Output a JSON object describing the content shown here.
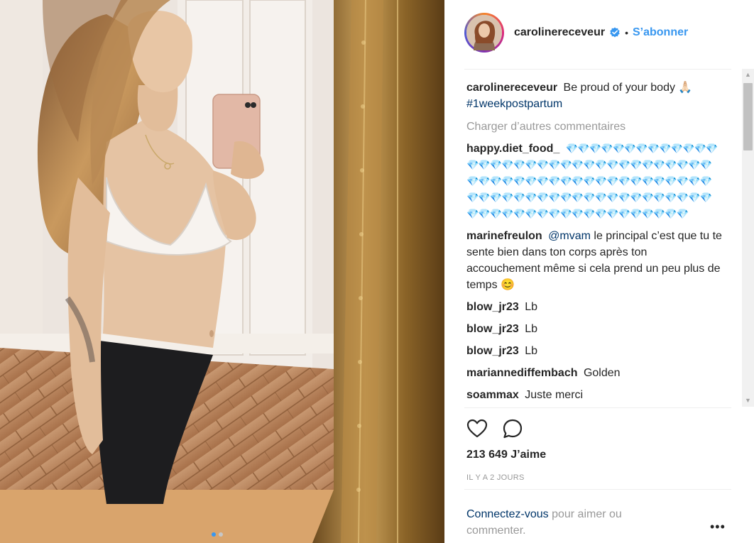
{
  "post": {
    "username": "carolinereceveur",
    "separator": "•",
    "follow_label": "S’abonner",
    "carousel": {
      "count": 2,
      "active": 1
    }
  },
  "caption": {
    "user": "carolinereceveur",
    "text": "Be proud of your body 🙏🏻",
    "hashtag": "#1weekpostpartum"
  },
  "load_more_label": "Charger d’autres commentaires",
  "comments": [
    {
      "user": "happy.diet_food_",
      "text": "💎💎💎💎💎💎💎💎💎💎💎💎💎💎💎💎💎💎💎💎💎💎💎💎💎💎💎💎💎💎💎💎💎💎💎💎💎💎💎💎💎💎💎💎💎💎💎💎💎💎💎💎💎💎💎💎💎💎💎💎💎💎💎💎💎💎💎💎💎💎💎💎💎💎💎💎💎💎💎💎💎💎💎💎💎💎💎💎💎💎💎💎💎💎💎"
    },
    {
      "user": "marinefreulon",
      "mention": "@mvam",
      "text": "le principal c’est que tu te sente bien dans ton corps après ton accouchement même si cela prend un peu plus de temps 😊"
    },
    {
      "user": "blow_jr23",
      "text": "Lb"
    },
    {
      "user": "blow_jr23",
      "text": "Lb"
    },
    {
      "user": "blow_jr23",
      "text": "Lb"
    },
    {
      "user": "mariannediffembach",
      "text": "Golden"
    },
    {
      "user": "soammax",
      "text": "Juste merci"
    }
  ],
  "likes_label": "213 649 J’aime",
  "date_label": "IL Y A 2 JOURS",
  "login": {
    "link": "Connectez-vous",
    "rest": "pour aimer ou commenter."
  },
  "more_label": "•••",
  "icons": {
    "like": "heart-outline-icon",
    "comment": "comment-bubble-icon",
    "verified": "verified-badge-icon",
    "more": "more-options-icon"
  },
  "colors": {
    "link": "#3897f0",
    "dark_link": "#003569",
    "muted": "#999999"
  }
}
